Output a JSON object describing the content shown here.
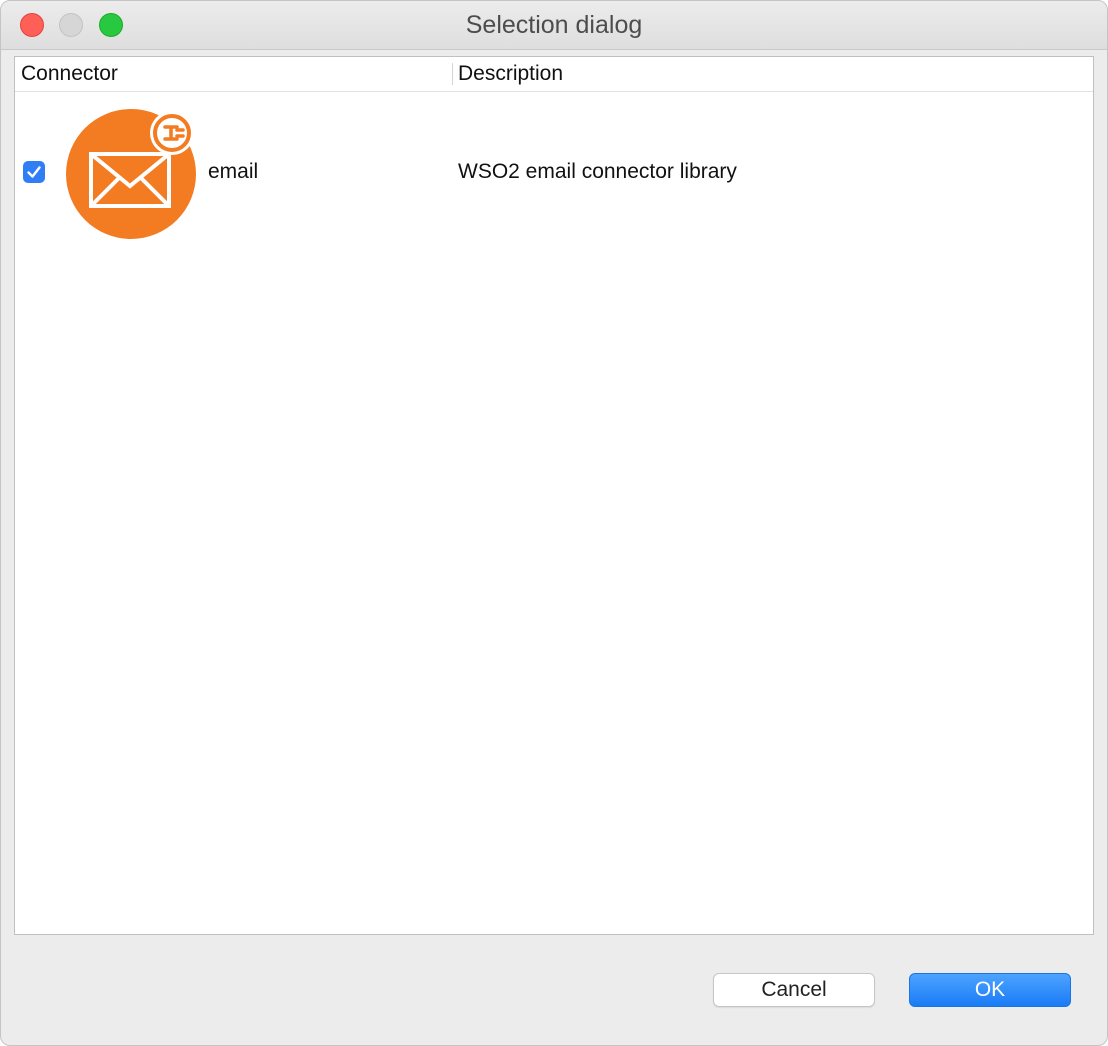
{
  "window": {
    "title": "Selection dialog"
  },
  "table": {
    "columns": [
      "Connector",
      "Description"
    ],
    "rows": [
      {
        "checked": true,
        "icon": "email-connector-icon",
        "name": "email",
        "description": "WSO2 email connector library"
      }
    ]
  },
  "buttons": {
    "cancel": "Cancel",
    "ok": "OK"
  },
  "colors": {
    "accent": "#2f7ef5",
    "connector_icon": "#f37b22"
  }
}
